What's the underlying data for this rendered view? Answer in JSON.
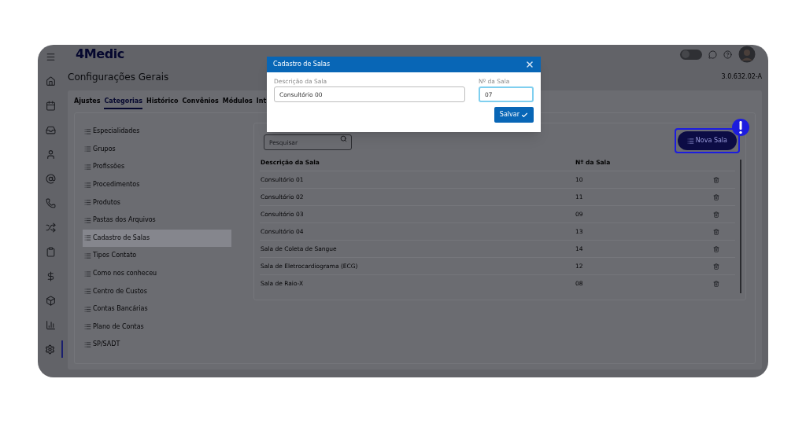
{
  "app": {
    "logo": "4Medic",
    "page_title": "Configurações Gerais",
    "version": "3.0.632.02-A",
    "dark_mode": false
  },
  "sidebar": {
    "items": [
      {
        "kind": "menu",
        "selected": false
      },
      {
        "kind": "home",
        "selected": false
      },
      {
        "kind": "calendar",
        "selected": false
      },
      {
        "kind": "inbox",
        "selected": false
      },
      {
        "kind": "user",
        "selected": false
      },
      {
        "kind": "at",
        "selected": false
      },
      {
        "kind": "phone",
        "selected": false
      },
      {
        "kind": "shuffle",
        "selected": false
      },
      {
        "kind": "clipboard",
        "selected": false
      },
      {
        "kind": "dollar",
        "selected": false
      },
      {
        "kind": "box",
        "selected": false
      },
      {
        "kind": "chart",
        "selected": false
      },
      {
        "kind": "settings",
        "selected": true
      }
    ]
  },
  "tabs": [
    {
      "label": "Ajustes",
      "selected": false
    },
    {
      "label": "Categorias",
      "selected": true
    },
    {
      "label": "Histórico",
      "selected": false
    },
    {
      "label": "Convênios",
      "selected": false
    },
    {
      "label": "Módulos",
      "selected": false
    },
    {
      "label": "Int",
      "selected": false
    }
  ],
  "categories": [
    {
      "label": "Especialidades",
      "selected": false
    },
    {
      "label": "Grupos",
      "selected": false
    },
    {
      "label": "Profissões",
      "selected": false
    },
    {
      "label": "Procedimentos",
      "selected": false
    },
    {
      "label": "Produtos",
      "selected": false
    },
    {
      "label": "Pastas dos Arquivos",
      "selected": false
    },
    {
      "label": "Cadastro de Salas",
      "selected": true
    },
    {
      "label": "Tipos Contato",
      "selected": false
    },
    {
      "label": "Como nos conheceu",
      "selected": false
    },
    {
      "label": "Centro de Custos",
      "selected": false
    },
    {
      "label": "Contas Bancárias",
      "selected": false
    },
    {
      "label": "Plano de Contas",
      "selected": false
    },
    {
      "label": "SP/SADT",
      "selected": false
    }
  ],
  "search": {
    "placeholder": "Pesquisar"
  },
  "new_button": {
    "label": "Nova Sala",
    "highlighted": true
  },
  "table": {
    "columns": [
      "Descrição da Sala",
      "Nº da Sala"
    ],
    "rows": [
      [
        "Consultório 01",
        "10"
      ],
      [
        "Consultório 02",
        "11"
      ],
      [
        "Consultório 03",
        "09"
      ],
      [
        "Consultório 04",
        "13"
      ],
      [
        "Sala de Coleta de Sangue",
        "14"
      ],
      [
        "Sala de Eletrocardiograma (ECG)",
        "12"
      ],
      [
        "Sala de Raio-X",
        "08"
      ]
    ]
  },
  "dialog": {
    "title": "Cadastro de Salas",
    "fields": [
      {
        "label": "Descrição da Sala",
        "value": "Consultório 00",
        "focused": false
      },
      {
        "label": "Nº da Sala",
        "value": "07",
        "focused": true
      }
    ],
    "save_button": "Salvar"
  }
}
